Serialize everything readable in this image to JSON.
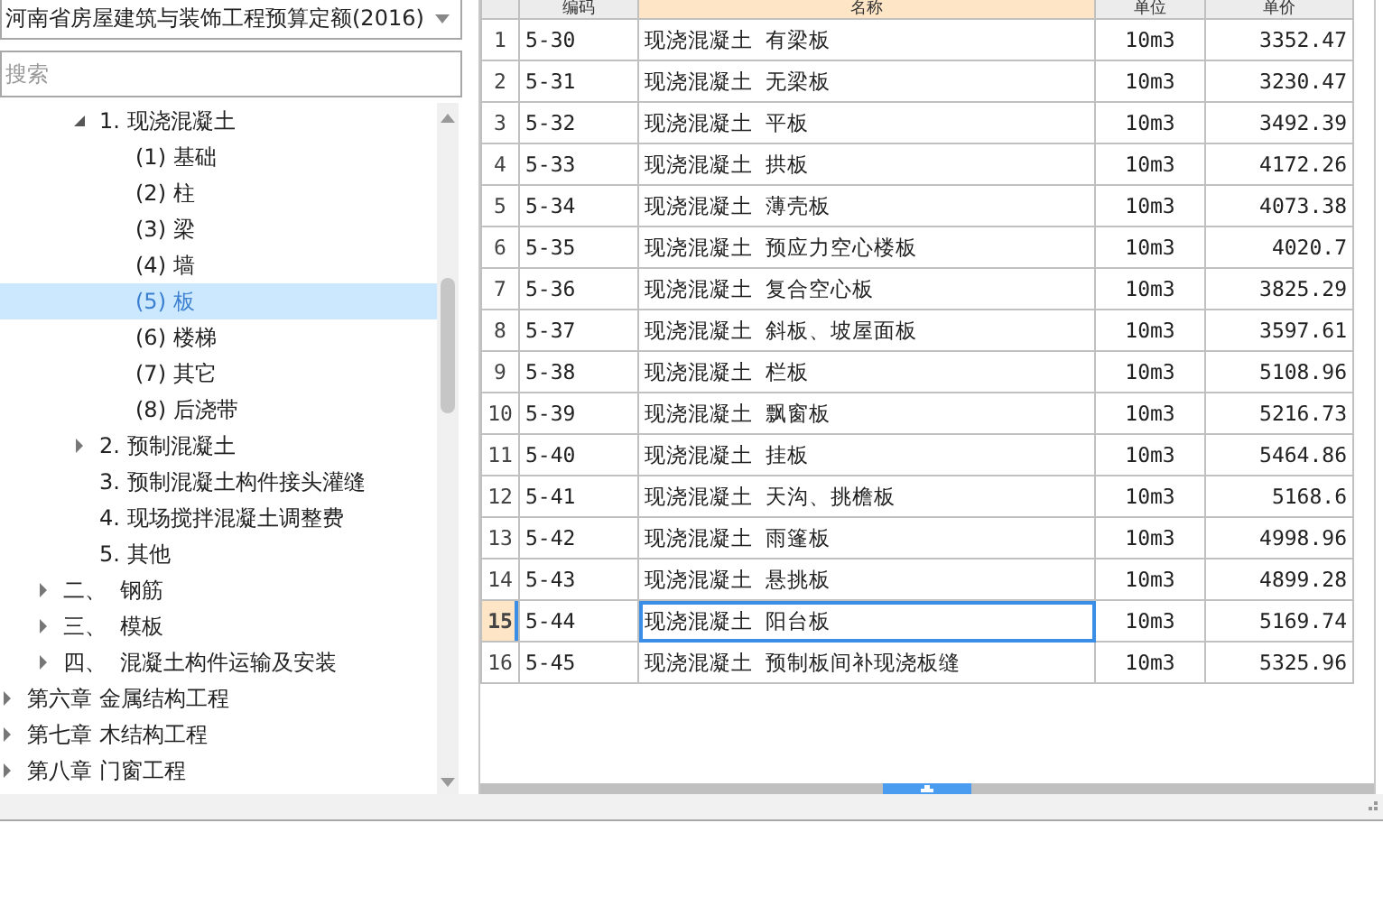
{
  "library_select": {
    "value": "河南省房屋建筑与装饰工程预算定额(2016)"
  },
  "search": {
    "placeholder": "搜索"
  },
  "tree": [
    {
      "children": [
        {
          "children": [
            {
              "label": "1. 现浇混凝土",
              "expanded": true,
              "selected": false,
              "children": [
                {
                  "label": "(1) 基础",
                  "selected": false
                },
                {
                  "label": "(2) 柱",
                  "selected": false
                },
                {
                  "label": "(3) 梁",
                  "selected": false
                },
                {
                  "label": "(4) 墙",
                  "selected": false
                },
                {
                  "label": "(5) 板",
                  "selected": true
                },
                {
                  "label": "(6) 楼梯",
                  "selected": false
                },
                {
                  "label": "(7) 其它",
                  "selected": false
                },
                {
                  "label": "(8) 后浇带",
                  "selected": false
                }
              ]
            },
            {
              "label": "2. 预制混凝土",
              "expanded": false,
              "selected": false
            },
            {
              "label": "3. 预制混凝土构件接头灌缝",
              "selected": false
            },
            {
              "label": "4. 现场搅拌混凝土调整费",
              "selected": false
            },
            {
              "label": "5. 其他",
              "selected": false
            }
          ]
        },
        {
          "label": "二、  钢筋",
          "expanded": false,
          "selected": false
        },
        {
          "label": "三、  模板",
          "expanded": false,
          "selected": false
        },
        {
          "label": "四、  混凝土构件运输及安装",
          "expanded": false,
          "selected": false
        }
      ]
    },
    {
      "label": "第六章 金属结构工程",
      "expanded": false,
      "selected": false
    },
    {
      "label": "第七章 木结构工程",
      "expanded": false,
      "selected": false
    },
    {
      "label": "第八章 门窗工程",
      "expanded": false,
      "selected": false
    }
  ],
  "table": {
    "columns": [
      "编码",
      "名称",
      "单位",
      "单价"
    ],
    "rows": [
      {
        "no": "1",
        "code": "5-30",
        "name": "现浇混凝土 有梁板",
        "unit": "10m3",
        "price": "3352.47",
        "selected": false
      },
      {
        "no": "2",
        "code": "5-31",
        "name": "现浇混凝土 无梁板",
        "unit": "10m3",
        "price": "3230.47",
        "selected": false
      },
      {
        "no": "3",
        "code": "5-32",
        "name": "现浇混凝土 平板",
        "unit": "10m3",
        "price": "3492.39",
        "selected": false
      },
      {
        "no": "4",
        "code": "5-33",
        "name": "现浇混凝土 拱板",
        "unit": "10m3",
        "price": "4172.26",
        "selected": false
      },
      {
        "no": "5",
        "code": "5-34",
        "name": "现浇混凝土 薄壳板",
        "unit": "10m3",
        "price": "4073.38",
        "selected": false
      },
      {
        "no": "6",
        "code": "5-35",
        "name": "现浇混凝土 预应力空心楼板",
        "unit": "10m3",
        "price": "4020.7",
        "selected": false
      },
      {
        "no": "7",
        "code": "5-36",
        "name": "现浇混凝土 复合空心板",
        "unit": "10m3",
        "price": "3825.29",
        "selected": false
      },
      {
        "no": "8",
        "code": "5-37",
        "name": "现浇混凝土 斜板、坡屋面板",
        "unit": "10m3",
        "price": "3597.61",
        "selected": false
      },
      {
        "no": "9",
        "code": "5-38",
        "name": "现浇混凝土 栏板",
        "unit": "10m3",
        "price": "5108.96",
        "selected": false
      },
      {
        "no": "10",
        "code": "5-39",
        "name": "现浇混凝土 飘窗板",
        "unit": "10m3",
        "price": "5216.73",
        "selected": false
      },
      {
        "no": "11",
        "code": "5-40",
        "name": "现浇混凝土 挂板",
        "unit": "10m3",
        "price": "5464.86",
        "selected": false
      },
      {
        "no": "12",
        "code": "5-41",
        "name": "现浇混凝土 天沟、挑檐板",
        "unit": "10m3",
        "price": "5168.6",
        "selected": false
      },
      {
        "no": "13",
        "code": "5-42",
        "name": "现浇混凝土 雨篷板",
        "unit": "10m3",
        "price": "4998.96",
        "selected": false
      },
      {
        "no": "14",
        "code": "5-43",
        "name": "现浇混凝土 悬挑板",
        "unit": "10m3",
        "price": "4899.28",
        "selected": false
      },
      {
        "no": "15",
        "code": "5-44",
        "name": "现浇混凝土 阳台板",
        "unit": "10m3",
        "price": "5169.74",
        "selected": true
      },
      {
        "no": "16",
        "code": "5-45",
        "name": "现浇混凝土 预制板间补现浇板缝",
        "unit": "10m3",
        "price": "5325.96",
        "selected": false
      }
    ]
  }
}
